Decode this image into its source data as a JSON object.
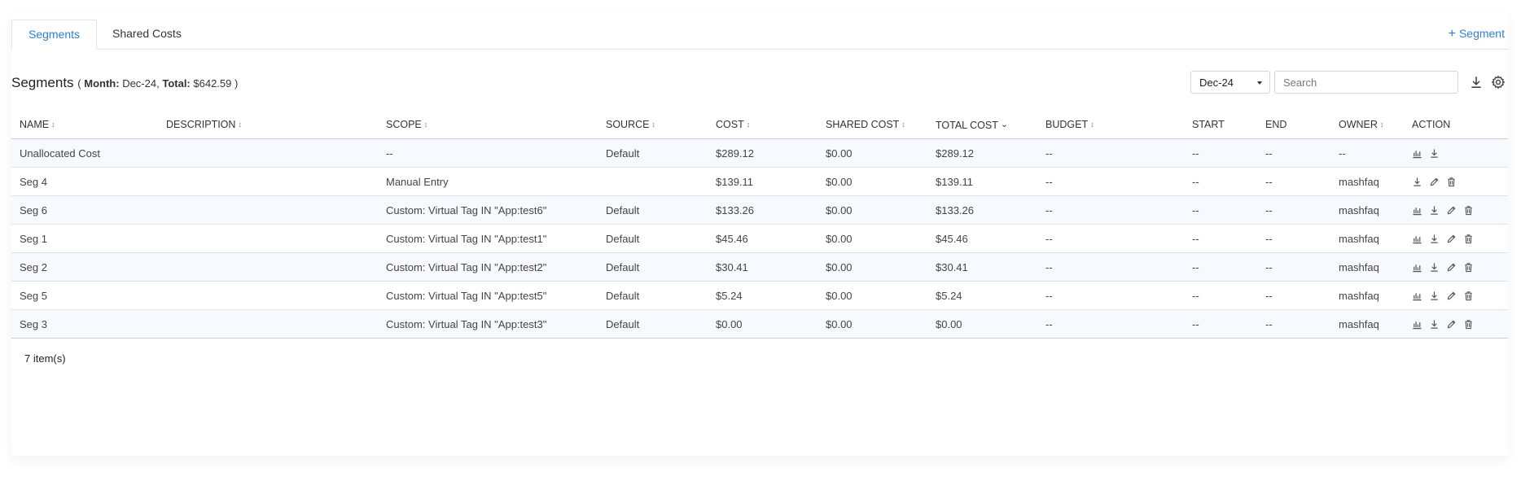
{
  "tabs": [
    {
      "label": "Segments",
      "active": true
    },
    {
      "label": "Shared Costs",
      "active": false
    }
  ],
  "add_segment_label": "Segment",
  "header": {
    "title": "Segments",
    "meta_open": "(",
    "month_label": "Month:",
    "month_value": "Dec-24,",
    "total_label": "Total:",
    "total_value": "$642.59",
    "meta_close": ")"
  },
  "month_select": {
    "value": "Dec-24"
  },
  "search": {
    "placeholder": "Search",
    "value": ""
  },
  "columns": [
    {
      "label": "NAME",
      "sort": "both"
    },
    {
      "label": "DESCRIPTION",
      "sort": "both"
    },
    {
      "label": "SCOPE",
      "sort": "both"
    },
    {
      "label": "SOURCE",
      "sort": "both"
    },
    {
      "label": "COST",
      "sort": "both"
    },
    {
      "label": "SHARED COST",
      "sort": "both"
    },
    {
      "label": "TOTAL COST",
      "sort": "desc"
    },
    {
      "label": "BUDGET",
      "sort": "both"
    },
    {
      "label": "START",
      "sort": "none"
    },
    {
      "label": "END",
      "sort": "none"
    },
    {
      "label": "OWNER",
      "sort": "both"
    },
    {
      "label": "ACTION",
      "sort": "none"
    }
  ],
  "rows": [
    {
      "name": "Unallocated Cost",
      "description": "",
      "scope": "--",
      "source": "Default",
      "cost": "$289.12",
      "shared_cost": "$0.00",
      "total_cost": "$289.12",
      "budget": "--",
      "start": "--",
      "end": "--",
      "owner": "--",
      "actions": [
        "chart",
        "download"
      ]
    },
    {
      "name": "Seg 4",
      "description": "",
      "scope": "Manual Entry",
      "source": "",
      "cost": "$139.11",
      "shared_cost": "$0.00",
      "total_cost": "$139.11",
      "budget": "--",
      "start": "--",
      "end": "--",
      "owner": "mashfaq",
      "actions": [
        "download",
        "edit",
        "delete"
      ]
    },
    {
      "name": "Seg 6",
      "description": "",
      "scope": "Custom: Virtual Tag IN \"App:test6\"",
      "source": "Default",
      "cost": "$133.26",
      "shared_cost": "$0.00",
      "total_cost": "$133.26",
      "budget": "--",
      "start": "--",
      "end": "--",
      "owner": "mashfaq",
      "actions": [
        "chart",
        "download",
        "edit",
        "delete"
      ]
    },
    {
      "name": "Seg 1",
      "description": "",
      "scope": "Custom: Virtual Tag IN \"App:test1\"",
      "source": "Default",
      "cost": "$45.46",
      "shared_cost": "$0.00",
      "total_cost": "$45.46",
      "budget": "--",
      "start": "--",
      "end": "--",
      "owner": "mashfaq",
      "actions": [
        "chart",
        "download",
        "edit",
        "delete"
      ]
    },
    {
      "name": "Seg 2",
      "description": "",
      "scope": "Custom: Virtual Tag IN \"App:test2\"",
      "source": "Default",
      "cost": "$30.41",
      "shared_cost": "$0.00",
      "total_cost": "$30.41",
      "budget": "--",
      "start": "--",
      "end": "--",
      "owner": "mashfaq",
      "actions": [
        "chart",
        "download",
        "edit",
        "delete"
      ]
    },
    {
      "name": "Seg 5",
      "description": "",
      "scope": "Custom: Virtual Tag IN \"App:test5\"",
      "source": "Default",
      "cost": "$5.24",
      "shared_cost": "$0.00",
      "total_cost": "$5.24",
      "budget": "--",
      "start": "--",
      "end": "--",
      "owner": "mashfaq",
      "actions": [
        "chart",
        "download",
        "edit",
        "delete"
      ]
    },
    {
      "name": "Seg 3",
      "description": "",
      "scope": "Custom: Virtual Tag IN \"App:test3\"",
      "source": "Default",
      "cost": "$0.00",
      "shared_cost": "$0.00",
      "total_cost": "$0.00",
      "budget": "--",
      "start": "--",
      "end": "--",
      "owner": "mashfaq",
      "actions": [
        "chart",
        "download",
        "edit",
        "delete"
      ]
    }
  ],
  "footer": {
    "count_label": "7 item(s)"
  },
  "colors": {
    "accent": "#2f7fd6",
    "row_stripe": "#f6f9fd"
  }
}
